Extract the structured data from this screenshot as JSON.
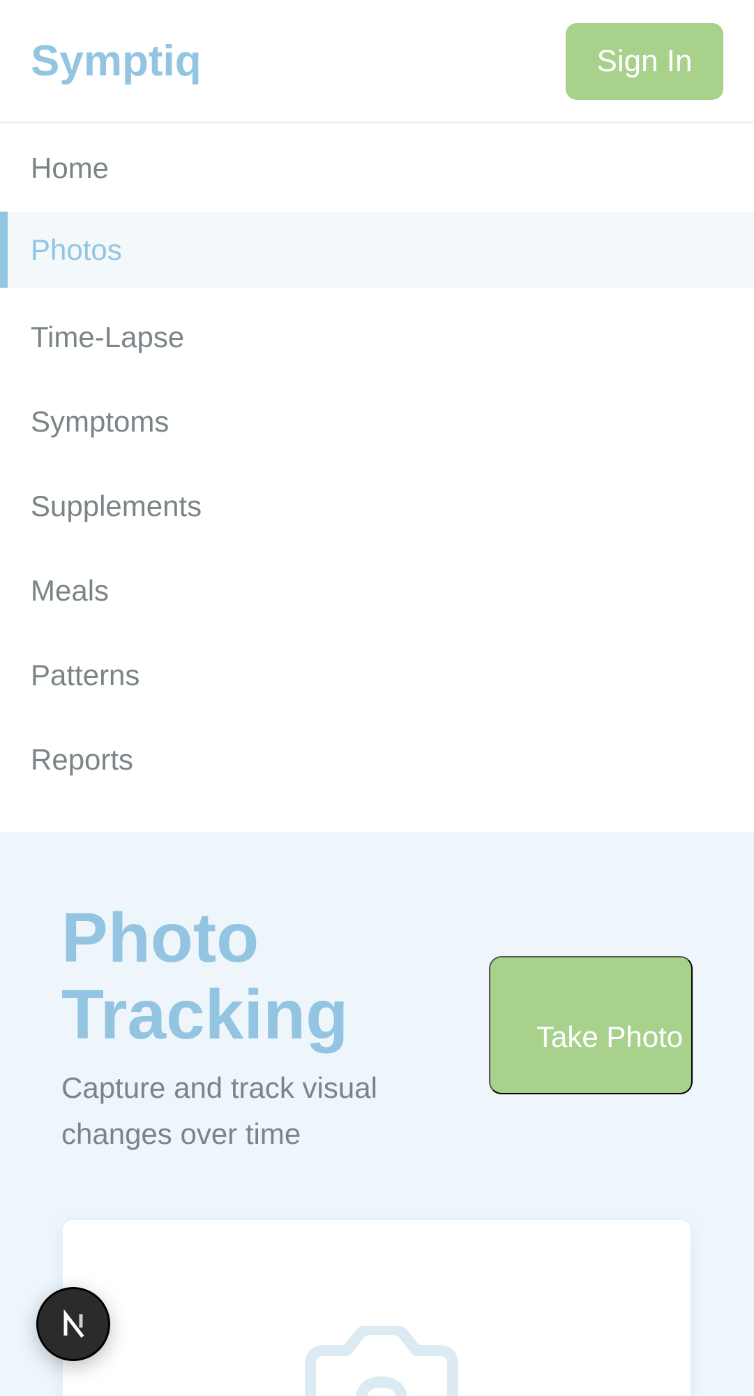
{
  "header": {
    "brand": "Symptiq",
    "signin_label": "Sign In"
  },
  "nav": {
    "items": [
      {
        "label": "Home",
        "active": false
      },
      {
        "label": "Photos",
        "active": true
      },
      {
        "label": "Time-Lapse",
        "active": false
      },
      {
        "label": "Symptoms",
        "active": false
      },
      {
        "label": "Supplements",
        "active": false
      },
      {
        "label": "Meals",
        "active": false
      },
      {
        "label": "Patterns",
        "active": false
      },
      {
        "label": "Reports",
        "active": false
      }
    ]
  },
  "hero": {
    "title": "Photo Tracking",
    "subtitle": "Capture and track visual changes over time",
    "take_photo_label": "Take Photo"
  },
  "card": {
    "icon": "camera-icon"
  },
  "badge": {
    "icon": "nextjs-logo-icon"
  },
  "colors": {
    "brand": "#93c5e2",
    "accent_green": "#a8d18c",
    "nav_text": "#7b8588",
    "hero_bg": "#eef6fc",
    "active_bg": "#f3f8fb"
  }
}
